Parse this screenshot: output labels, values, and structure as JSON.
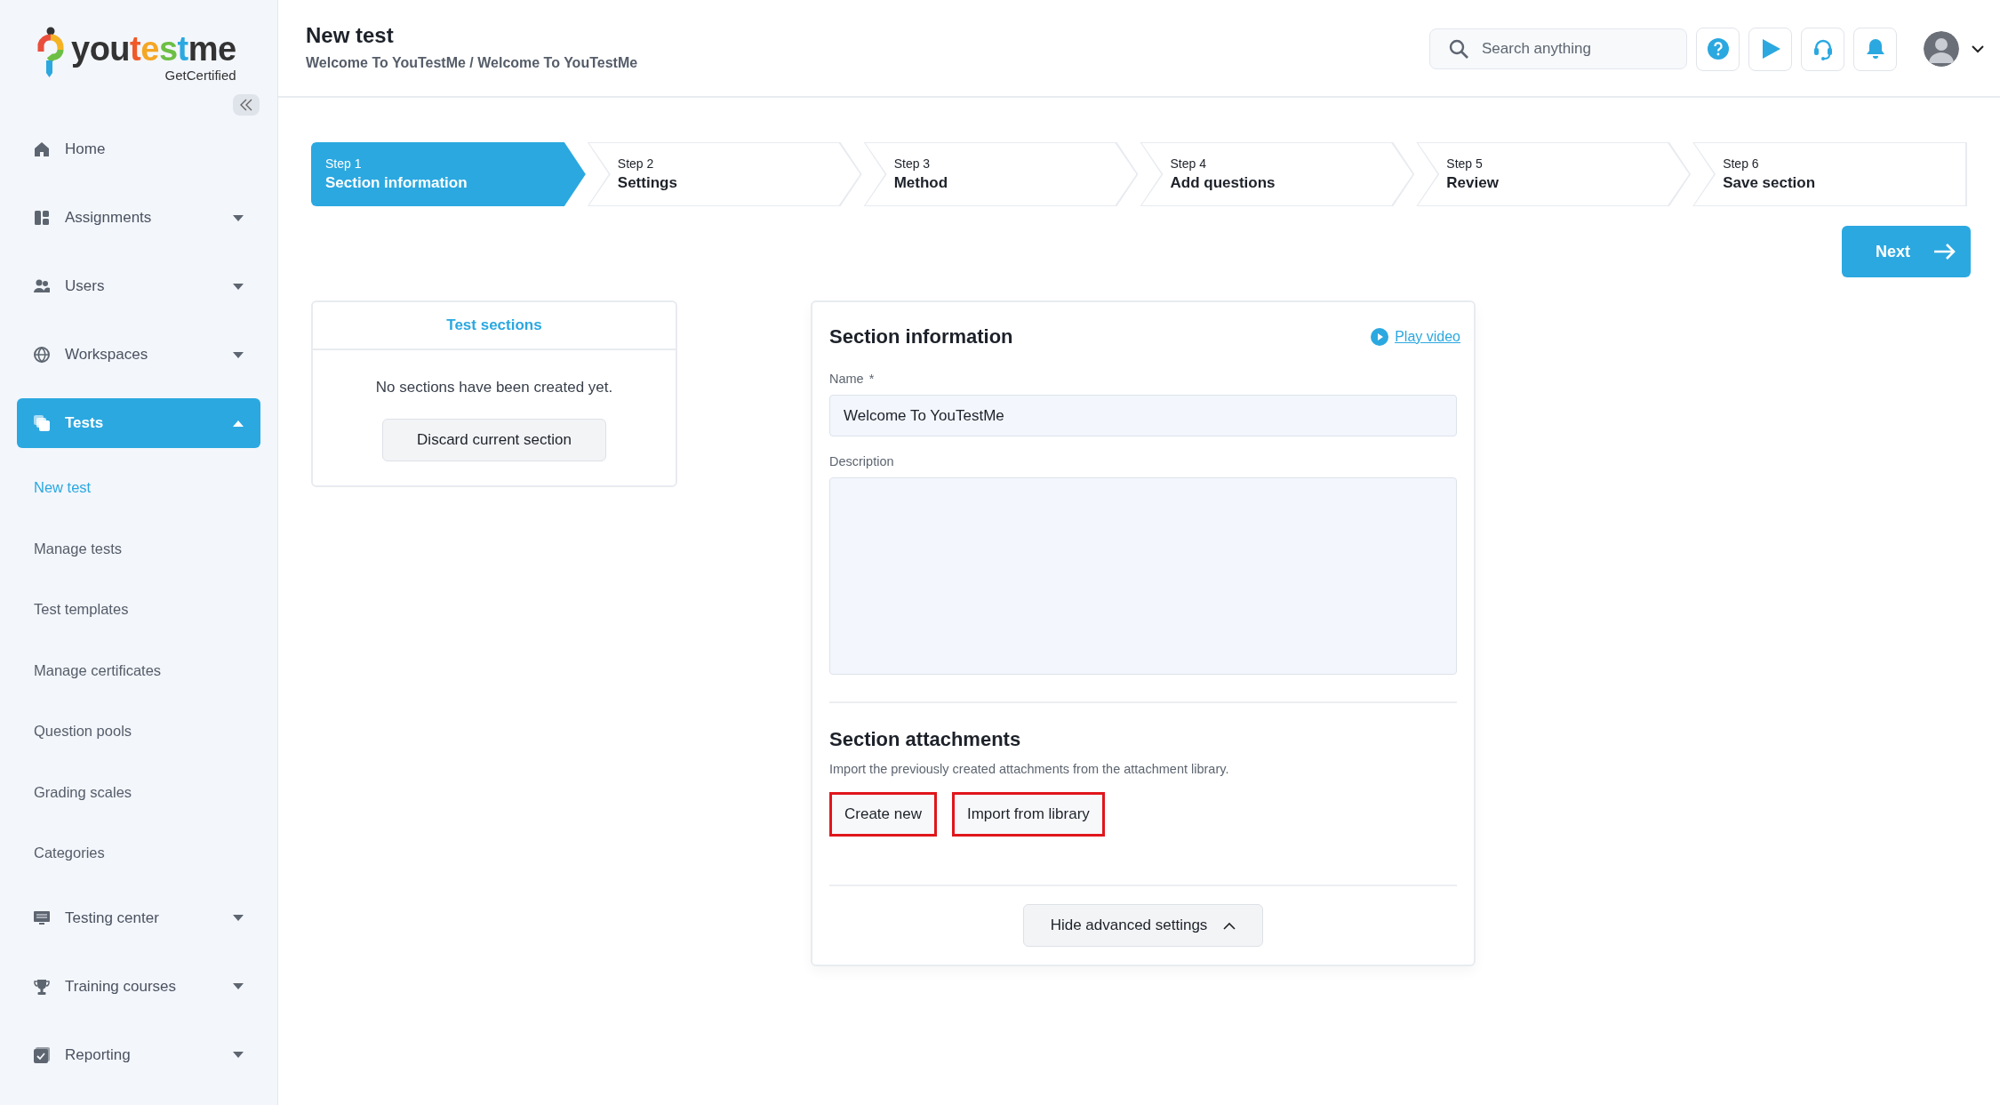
{
  "logo": {
    "name": "youtestme",
    "tagline": "GetCertified"
  },
  "sidebar": {
    "items": [
      {
        "label": "Home",
        "kind": "link",
        "selected": false
      },
      {
        "label": "Assignments",
        "kind": "menu",
        "selected": false,
        "expanded": false
      },
      {
        "label": "Users",
        "kind": "menu",
        "selected": false,
        "expanded": false
      },
      {
        "label": "Workspaces",
        "kind": "menu",
        "selected": false,
        "expanded": false
      },
      {
        "label": "Tests",
        "kind": "menu",
        "selected": true,
        "expanded": true,
        "children": [
          {
            "label": "New test",
            "selected": true
          },
          {
            "label": "Manage tests",
            "selected": false
          },
          {
            "label": "Test templates",
            "selected": false
          },
          {
            "label": "Manage certificates",
            "selected": false
          },
          {
            "label": "Question pools",
            "selected": false
          },
          {
            "label": "Grading scales",
            "selected": false
          },
          {
            "label": "Categories",
            "selected": false
          }
        ]
      },
      {
        "label": "Testing center",
        "kind": "menu",
        "selected": false,
        "expanded": false
      },
      {
        "label": "Training courses",
        "kind": "menu",
        "selected": false,
        "expanded": false
      },
      {
        "label": "Reporting",
        "kind": "menu",
        "selected": false,
        "expanded": false
      }
    ]
  },
  "header": {
    "title": "New test",
    "breadcrumb": "Welcome To YouTestMe / Welcome To YouTestMe",
    "search": {
      "placeholder": "Search anything"
    }
  },
  "steps": [
    {
      "step": "Step 1",
      "label": "Section information",
      "selected": true
    },
    {
      "step": "Step 2",
      "label": "Settings",
      "selected": false
    },
    {
      "step": "Step 3",
      "label": "Method",
      "selected": false
    },
    {
      "step": "Step 4",
      "label": "Add questions",
      "selected": false
    },
    {
      "step": "Step 5",
      "label": "Review",
      "selected": false
    },
    {
      "step": "Step 6",
      "label": "Save section",
      "selected": false
    }
  ],
  "next_button": "Next",
  "test_sections": {
    "title": "Test sections",
    "message": "No sections have been created yet.",
    "button": "Discard current section"
  },
  "section_information": {
    "title": "Section information",
    "video_link": "Play video",
    "name": {
      "label": "Name",
      "required_mark": "*",
      "value": "Welcome To YouTestMe"
    },
    "description": {
      "label": "Description"
    },
    "attachments": {
      "title": "Section attachments",
      "hint": "Import the previously created attachments from the attachment library.",
      "buttons": [
        {
          "label": "Create new",
          "highlighted": true
        },
        {
          "label": "Import from library",
          "highlighted": true
        }
      ]
    },
    "advanced_toggle": {
      "label": "Hide advanced settings",
      "expanded": true
    }
  }
}
